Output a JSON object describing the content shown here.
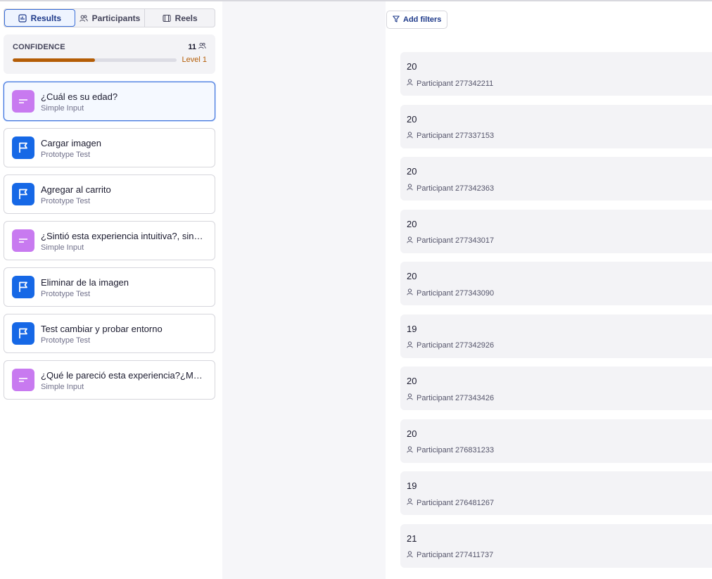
{
  "tabs": [
    {
      "label": "Results",
      "icon": "bar-chart-icon"
    },
    {
      "label": "Participants",
      "icon": "users-icon"
    },
    {
      "label": "Reels",
      "icon": "film-icon"
    }
  ],
  "confidence": {
    "title": "CONFIDENCE",
    "count": "11",
    "level": "Level 1",
    "progress": 0.5
  },
  "questions": [
    {
      "title": "¿Cuál es su edad?",
      "type": "Simple Input",
      "icon": "text-input-icon"
    },
    {
      "title": "Cargar imagen",
      "type": "Prototype Test",
      "icon": "flag-icon"
    },
    {
      "title": "Agregar al carrito",
      "type": "Prototype Test",
      "icon": "flag-icon"
    },
    {
      "title": "¿Sintió esta experiencia intuitiva?, sin…",
      "type": "Simple Input",
      "icon": "text-input-icon"
    },
    {
      "title": "Eliminar de la imagen",
      "type": "Prototype Test",
      "icon": "flag-icon"
    },
    {
      "title": "Test cambiar y probar entorno",
      "type": "Prototype Test",
      "icon": "flag-icon"
    },
    {
      "title": "¿Qué le pareció esta experiencia?¿Me…",
      "type": "Simple Input",
      "icon": "text-input-icon"
    }
  ],
  "filters": {
    "label": "Add filters",
    "icon": "filter-icon"
  },
  "responses": [
    {
      "value": "20",
      "participant": "Participant 277342211"
    },
    {
      "value": "20",
      "participant": "Participant 277337153"
    },
    {
      "value": "20",
      "participant": "Participant 277342363"
    },
    {
      "value": "20",
      "participant": "Participant 277343017"
    },
    {
      "value": "20",
      "participant": "Participant 277343090"
    },
    {
      "value": "19",
      "participant": "Participant 277342926"
    },
    {
      "value": "20",
      "participant": "Participant 277343426"
    },
    {
      "value": "20",
      "participant": "Participant 276831233"
    },
    {
      "value": "19",
      "participant": "Participant 276481267"
    },
    {
      "value": "21",
      "participant": "Participant 277411737"
    }
  ],
  "colors": {
    "accent": "#1e3a8a",
    "confidence": "#b45d06",
    "input_icon": "#c87af0",
    "prototype_icon": "#1668e6"
  }
}
